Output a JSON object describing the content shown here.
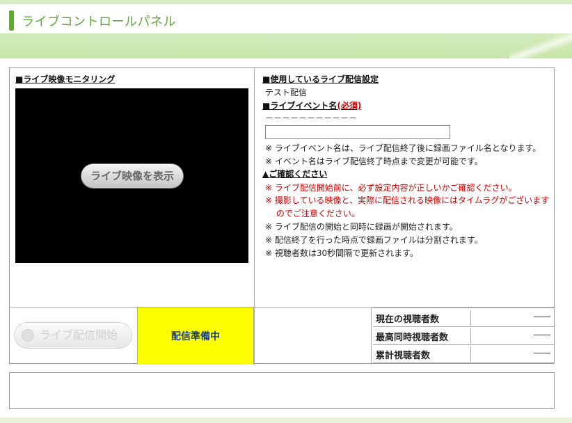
{
  "header": {
    "title": "ライブコントロールパネル"
  },
  "monitor": {
    "title": "■ライブ映像モニタリング",
    "show_button": "ライブ映像を表示"
  },
  "settings": {
    "title": "■使用しているライブ配信設定",
    "value": "テスト配信",
    "event_title": "■ライブイベント名",
    "event_required": "(必須)",
    "event_dashes": "－－－－－－－－－－－",
    "event_input_value": "",
    "notes": [
      "※ ライブイベント名は、ライブ配信終了後に録画ファイル名となります。",
      "※ イベント名はライブ配信終了時点まで変更が可能です。"
    ],
    "confirm_title": "▲ご確認ください",
    "warnings": [
      "※ ライブ配信開始前に、必ず設定内容が正しいかご確認ください。",
      "※ 撮影している映像と、実際に配信される映像にはタイムラグがございます",
      "　 のでご注意ください。"
    ],
    "info": [
      "※ ライブ配信の開始と同時に録画が開始されます。",
      "※ 配信終了を行った時点で録画ファイルは分割されます。",
      "※ 視聴者数は30秒間隔で更新されます。"
    ]
  },
  "controls": {
    "start_button": "ライブ配信開始",
    "status": "配信準備中",
    "stats": [
      {
        "label": "現在の視聴者数",
        "value": "――"
      },
      {
        "label": "最高同時視聴者数",
        "value": "――"
      },
      {
        "label": "累計視聴者数",
        "value": "――"
      }
    ]
  },
  "colors": {
    "accent": "#5cae25",
    "status_bg": "#ffff00",
    "warning": "#cc0000"
  }
}
